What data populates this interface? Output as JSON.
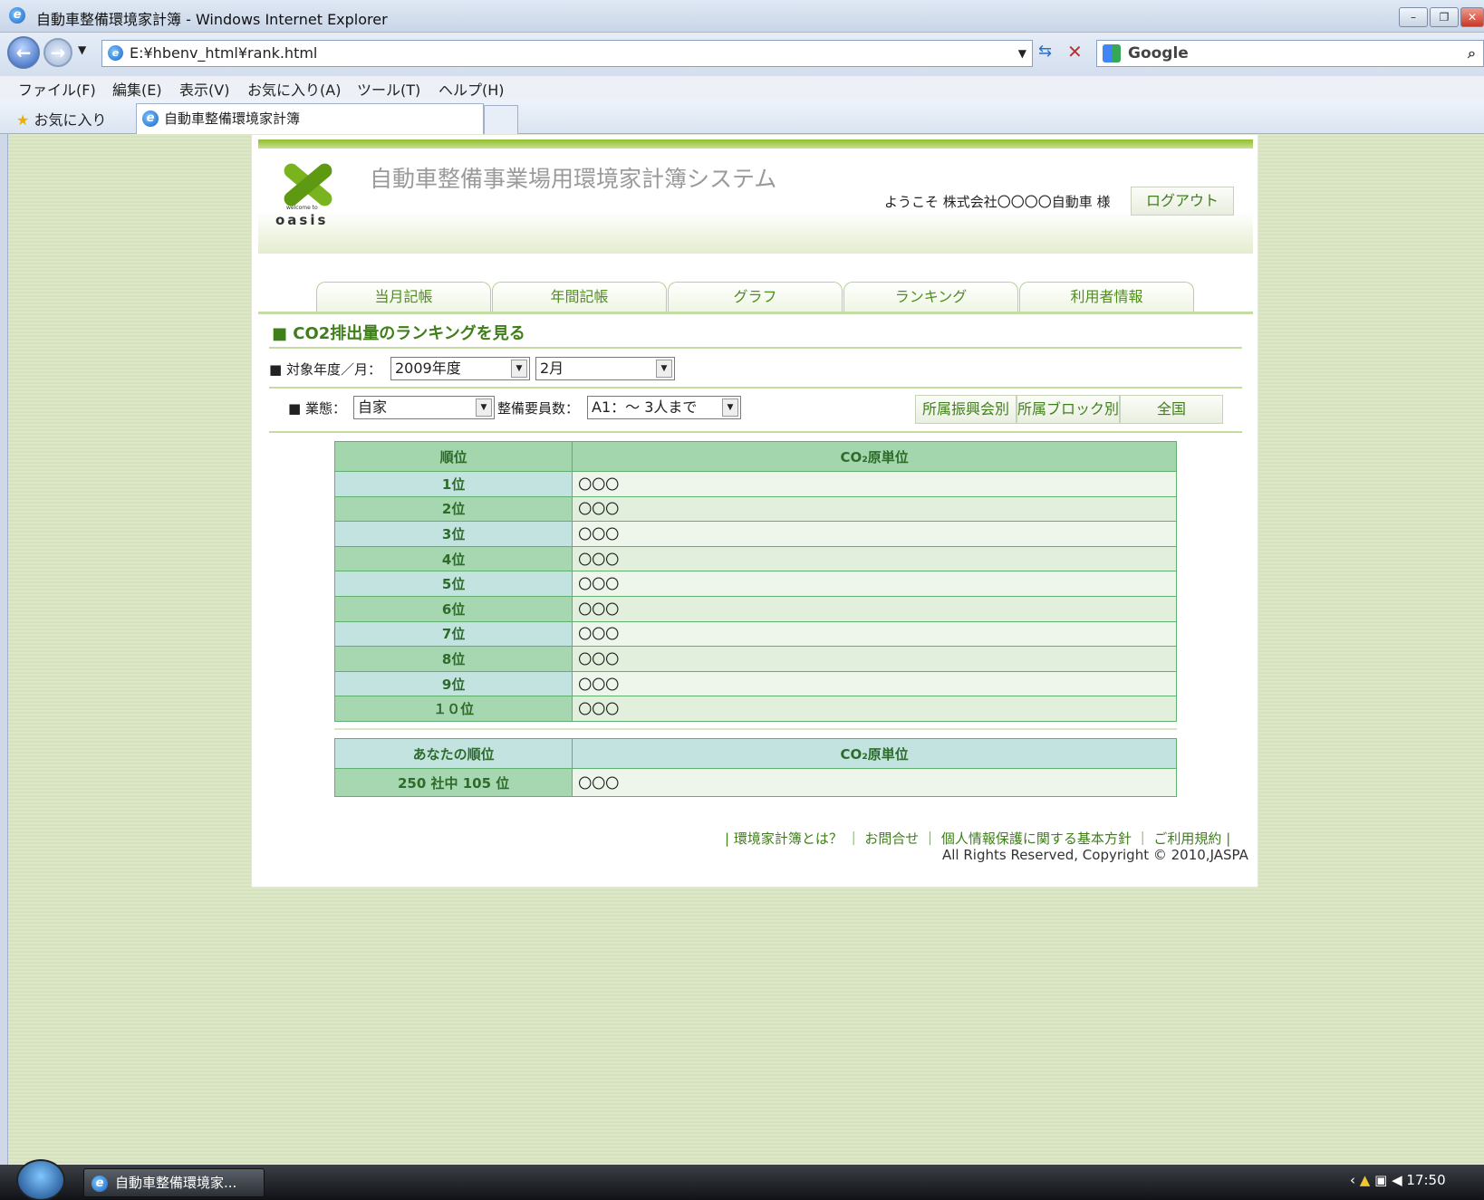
{
  "window": {
    "title": "自動車整備環境家計簿 - Windows Internet Explorer"
  },
  "browser": {
    "address": "E:¥hbenv_html¥rank.html",
    "search_provider": "Google"
  },
  "menu": [
    "ファイル(F)",
    "編集(E)",
    "表示(V)",
    "お気に入り(A)",
    "ツール(T)",
    "ヘルプ(H)"
  ],
  "favorites": {
    "label": "お気に入り",
    "tab_title": "自動車整備環境家計簿"
  },
  "header": {
    "logo_text": "oasis",
    "logo_small": "welcome to",
    "system_title": "自動車整備事業場用環境家計簿システム",
    "welcome": "ようこそ 株式会社〇〇〇〇自動車 様",
    "logout": "ログアウト"
  },
  "tabs": [
    "当月記帳",
    "年間記帳",
    "グラフ",
    "ランキング",
    "利用者情報"
  ],
  "section": {
    "title": "■ CO2排出量のランキングを見る"
  },
  "filters": {
    "period_label": "■ 対象年度／月：",
    "year": "2009年度",
    "month": "2月",
    "business_label": "■ 業態：",
    "business": "自家",
    "staff_label": "整備要員数：",
    "staff": "A1：～ 3人まで"
  },
  "filter_buttons": [
    "所属振興会別",
    "所属ブロック別",
    "全国"
  ],
  "ranking": {
    "col_rank": "順位",
    "col_unit": "CO₂原単位",
    "rows": [
      {
        "rank": "1位",
        "value": "〇〇〇"
      },
      {
        "rank": "2位",
        "value": "〇〇〇"
      },
      {
        "rank": "3位",
        "value": "〇〇〇"
      },
      {
        "rank": "4位",
        "value": "〇〇〇"
      },
      {
        "rank": "5位",
        "value": "〇〇〇"
      },
      {
        "rank": "6位",
        "value": "〇〇〇"
      },
      {
        "rank": "7位",
        "value": "〇〇〇"
      },
      {
        "rank": "8位",
        "value": "〇〇〇"
      },
      {
        "rank": "9位",
        "value": "〇〇〇"
      },
      {
        "rank": "１０位",
        "value": "〇〇〇"
      }
    ]
  },
  "your_rank": {
    "col_rank": "あなたの順位",
    "col_unit": "CO₂原単位",
    "rank": "250 社中 105 位",
    "value": "〇〇〇"
  },
  "footer": {
    "links": "| 環境家計簿とは？ ｜ お問合せ ｜ 個人情報保護に関する基本方針 ｜ ご利用規約 |",
    "copyright": "All Rights Reserved, Copyright © 2010,JASPA"
  },
  "taskbar": {
    "item": "自動車整備環境家...",
    "clock": "17:50"
  },
  "colors": {
    "accent": "#3f7f1a",
    "table_header": "#a4d6ae"
  }
}
